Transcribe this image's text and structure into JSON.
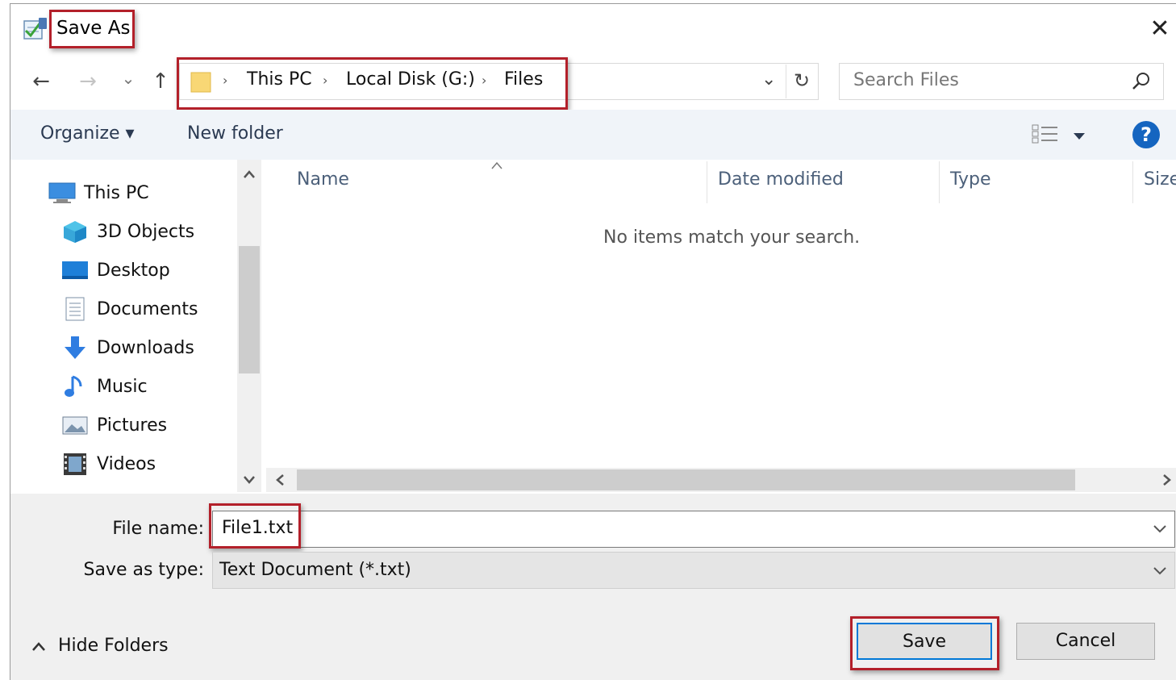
{
  "window": {
    "title": "Save As",
    "close_glyph": "✕"
  },
  "nav": {
    "back_glyph": "←",
    "forward_glyph": "→",
    "recent_glyph": "⌄",
    "up_glyph": "↑",
    "breadcrumb": [
      "This PC",
      "Local Disk (G:)",
      "Files"
    ],
    "breadcrumb_separator": "›",
    "dropdown_glyph": "⌄",
    "refresh_glyph": "↻",
    "search_placeholder": "Search Files"
  },
  "toolbar": {
    "organize_label": "Organize ▾",
    "new_folder_label": "New folder",
    "help_glyph": "?"
  },
  "sidebar": {
    "items": [
      {
        "label": "This PC",
        "icon": "this-pc-icon"
      },
      {
        "label": "3D Objects",
        "icon": "3d-objects-icon"
      },
      {
        "label": "Desktop",
        "icon": "desktop-icon"
      },
      {
        "label": "Documents",
        "icon": "documents-icon"
      },
      {
        "label": "Downloads",
        "icon": "downloads-icon"
      },
      {
        "label": "Music",
        "icon": "music-icon"
      },
      {
        "label": "Pictures",
        "icon": "pictures-icon"
      },
      {
        "label": "Videos",
        "icon": "videos-icon"
      }
    ]
  },
  "file_list": {
    "columns": [
      "Name",
      "Date modified",
      "Type",
      "Size"
    ],
    "empty_message": "No items match your search."
  },
  "form": {
    "file_name_label": "File name:",
    "file_name_value": "File1.txt",
    "save_type_label": "Save as type:",
    "save_type_value": "Text Document (*.txt)"
  },
  "footer": {
    "hide_folders_label": "Hide Folders",
    "save_label": "Save",
    "cancel_label": "Cancel"
  },
  "colors": {
    "highlight": "#b3202a",
    "primary_border": "#0078d7",
    "toolbar_bg": "#f0f4f9",
    "help_blue": "#1565c0"
  }
}
